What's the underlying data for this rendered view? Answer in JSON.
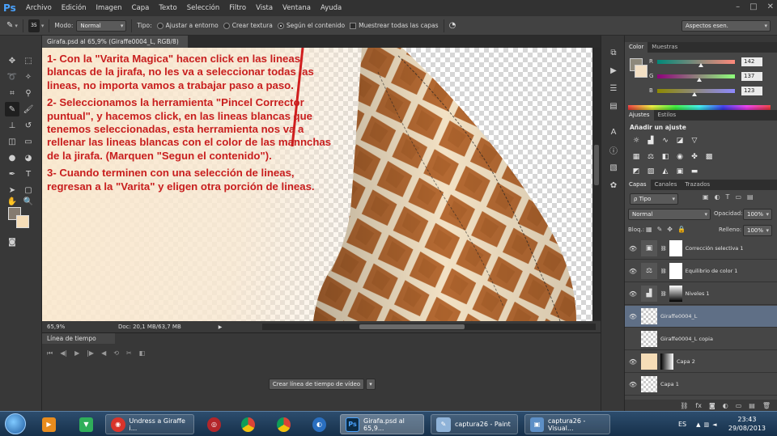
{
  "app": {
    "logo": "Ps",
    "menu": [
      "Archivo",
      "Edición",
      "Imagen",
      "Capa",
      "Texto",
      "Selección",
      "Filtro",
      "Vista",
      "Ventana",
      "Ayuda"
    ],
    "window_controls": [
      "–",
      "□",
      "✕"
    ]
  },
  "options": {
    "brush_size": "35",
    "mode_label": "Modo:",
    "mode_value": "Normal",
    "type_label": "Tipo:",
    "radio_1": "Ajustar a entorno",
    "radio_2": "Crear textura",
    "radio_3": "Según el contenido",
    "sample_all": "Muestrear todas las capas",
    "workspace": "Aspectos esen."
  },
  "document": {
    "tab_title": "Girafa.psd al 65,9% (Giraffe0004_L, RGB/8) *",
    "close": "×",
    "zoom": "65,9%",
    "doc_info": "Doc: 20,1 MB/63,7 MB"
  },
  "annotation": {
    "step1": "1- Con la \"Varita Magica\" hacen click en las lineas blancas de la jirafa, no les va a seleccionar todas las lineas, no importa vamos a trabajar paso a paso.",
    "step2": "2- Seleccionamos la herramienta \"Pincel Corrector puntual\", y hacemos click, en las lineas blancas que tenemos seleccionadas, esta herramienta nos va a rellenar las lineas blancas con el color de las mannchas de la jirafa. (Marquen \"Segun el contenido\").",
    "step3": "3- Cuando terminen con una selección de lineas, regresan a la \"Varita\" y eligen otra porción de lineas."
  },
  "timeline": {
    "tab": "Línea de tiempo",
    "create_button": "Crear línea de tiempo de vídeo",
    "controls": [
      "⏮",
      "◀|",
      "▶",
      "|▶",
      "◀",
      "⟲",
      "✂",
      "◧"
    ]
  },
  "color_panel": {
    "tabs": [
      "Color",
      "Muestras"
    ],
    "r_label": "R",
    "r_value": "142",
    "g_label": "G",
    "g_value": "137",
    "b_label": "B",
    "b_value": "123"
  },
  "adjust_panel": {
    "tabs": [
      "Ajustes",
      "Estilos"
    ],
    "title": "Añadir un ajuste"
  },
  "layers_panel": {
    "tabs": [
      "Capas",
      "Canales",
      "Trazados"
    ],
    "filter": "ρ Tipo",
    "blend_mode": "Normal",
    "opacity_label": "Opacidad:",
    "opacity_value": "100%",
    "lock_label": "Bloq.:",
    "fill_label": "Relleno:",
    "fill_value": "100%",
    "layers": [
      {
        "name": "Corrección selectiva 1"
      },
      {
        "name": "Equilibrio de color 1"
      },
      {
        "name": "Niveles 1"
      },
      {
        "name": "Giraffe0004_L"
      },
      {
        "name": "Giraffe0004_L copia"
      },
      {
        "name": "Capa 2"
      },
      {
        "name": "Capa 1"
      }
    ],
    "footer_icons": [
      "⛓",
      "fx",
      "◙",
      "◐",
      "▭",
      "▤",
      "🗑"
    ]
  },
  "taskbar": {
    "items": [
      {
        "label": "Undress a Giraffe i..."
      },
      {
        "label": "Girafa.psd al 65,9..."
      },
      {
        "label": "captura26 - Paint"
      },
      {
        "label": "captura26 - Visual..."
      }
    ],
    "lang": "ES",
    "time": "23:43",
    "date": "29/08/2013"
  },
  "colors": {
    "annotation": "#c81e1e",
    "selected_layer": "#5f6f86",
    "giraffe_patch": "#b56a33",
    "giraffe_line": "#f2e1c4"
  }
}
